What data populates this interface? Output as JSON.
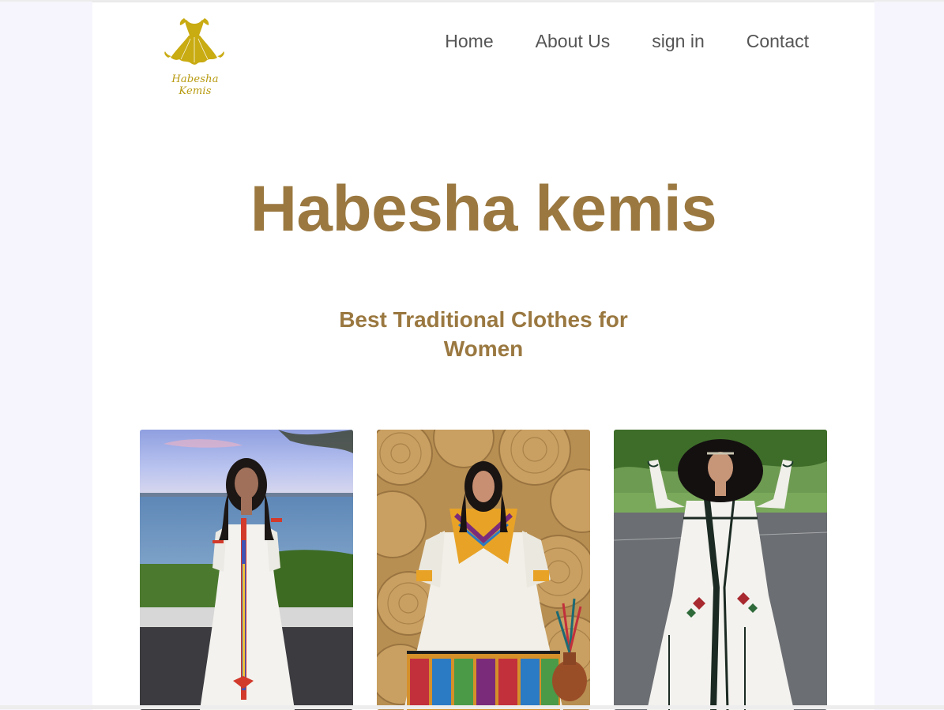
{
  "brand": {
    "logo_text": "Habesha Kemis",
    "logo_color": "#c9ab12"
  },
  "nav": {
    "items": [
      "Home",
      "About Us",
      "sign in",
      "Contact"
    ]
  },
  "hero": {
    "title": "Habesha kemis",
    "subtitle": "Best Traditional Clothes for Women",
    "accent_color": "#9a7840"
  },
  "gallery": {
    "photos": [
      {
        "icon": "photo-woman-lakeside-white-dress"
      },
      {
        "icon": "photo-woman-woven-wall-colorful-dress"
      },
      {
        "icon": "photo-woman-road-embroidered-dress"
      }
    ]
  }
}
